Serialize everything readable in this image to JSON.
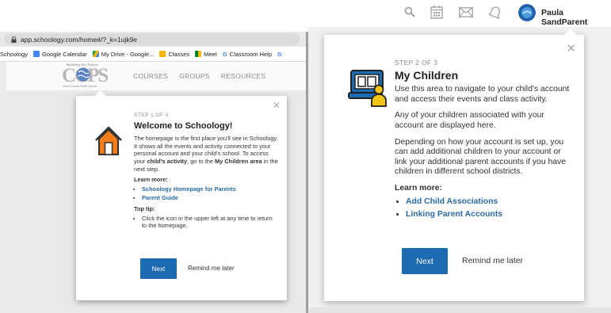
{
  "browser": {
    "url": "app.schoology.com/home#/?_k=1ujk9e",
    "bookmarks": [
      {
        "label": "Schoology",
        "icon": "schoology-icon"
      },
      {
        "label": "Google Calendar",
        "icon": "calendar-icon"
      },
      {
        "label": "My Drive - Google...",
        "icon": "drive-icon"
      },
      {
        "label": "Classes",
        "icon": "classroom-icon"
      },
      {
        "label": "Meet",
        "icon": "meet-icon"
      },
      {
        "label": "Classroom Help",
        "icon": "google-icon"
      },
      {
        "label": "G",
        "icon": "google-icon"
      }
    ]
  },
  "site_nav": {
    "logo_tagline": "Building the Future",
    "logo_text": "CCPS",
    "logo_sub": "Carroll County Public Schools",
    "links": [
      "COURSES",
      "GROUPS",
      "RESOURCES"
    ]
  },
  "tour_step1": {
    "step": "STEP 1 OF 3",
    "title": "Welcome to Schoology!",
    "text_a": "The homepage is the first place you'll see in Schoology. It shows all the events and activity connected to your personal account and your child's school. To access your ",
    "text_b": "child's activity",
    "text_c": ", go to the ",
    "text_d": "My Children area",
    "text_e": " in the next step.",
    "learn_more": "Learn more:",
    "links": [
      "Schoology Homepage for Parents",
      "Parent Guide"
    ],
    "tip_heading": "Top tip:",
    "tip": "Click the icon in the upper left at any time to return to the homepage.",
    "next_label": "Next",
    "remind_label": "Remind me later"
  },
  "top_bar": {
    "user_name": "Paula SandParent"
  },
  "tour_step2": {
    "step": "STEP 2 OF 3",
    "title": "My Children",
    "p1": "Use this area to navigate to your child's account and access their events and class activity.",
    "p2": "Any of your children associated with your account are displayed here.",
    "p3": "Depending on how your account is set up, you can add additional children to your account or link your additional parent accounts if you have children in different school districts.",
    "learn_more": "Learn more:",
    "links": [
      "Add Child Associations",
      "Linking Parent Accounts"
    ],
    "next_label": "Next",
    "remind_label": "Remind me later"
  },
  "colors": {
    "primary_button": "#1d6bb1",
    "link": "#2a6ba5",
    "illustration_orange": "#f07d1a",
    "illustration_blue": "#1d6bb1",
    "illustration_yellow": "#f5c518"
  }
}
